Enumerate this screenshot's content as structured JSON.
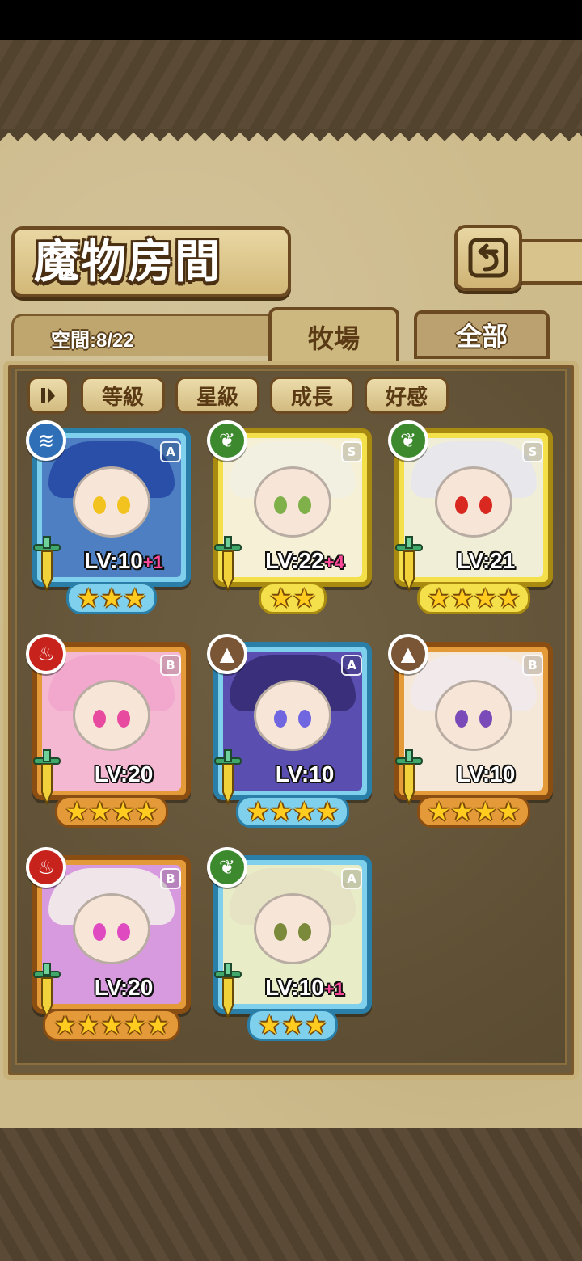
{
  "header": {
    "title": "魔物房間",
    "back_label": "返回"
  },
  "space": {
    "label": "空間:8/22"
  },
  "tabs": [
    {
      "label": "牧場",
      "active": true
    },
    {
      "label": "全部",
      "active": false
    }
  ],
  "sort": {
    "toggle_icon": "sort-toggle-icon",
    "buttons": [
      "等級",
      "星級",
      "成長",
      "好感"
    ]
  },
  "monsters": [
    {
      "level": "LV:10",
      "bonus": "+1",
      "rank": "A",
      "element": "water",
      "stars": 3,
      "frame": "blue"
    },
    {
      "level": "LV:22",
      "bonus": "+4",
      "rank": "S",
      "element": "nature",
      "stars": 2,
      "frame": "gold"
    },
    {
      "level": "LV:21",
      "bonus": "",
      "rank": "S",
      "element": "nature",
      "stars": 4,
      "frame": "gold"
    },
    {
      "level": "LV:20",
      "bonus": "",
      "rank": "B",
      "element": "fire",
      "stars": 4,
      "frame": "orange"
    },
    {
      "level": "LV:10",
      "bonus": "",
      "rank": "A",
      "element": "earth",
      "stars": 4,
      "frame": "blue"
    },
    {
      "level": "LV:10",
      "bonus": "",
      "rank": "B",
      "element": "earth",
      "stars": 4,
      "frame": "orange"
    },
    {
      "level": "LV:20",
      "bonus": "",
      "rank": "B",
      "element": "fire",
      "stars": 5,
      "frame": "orange"
    },
    {
      "level": "LV:10",
      "bonus": "+1",
      "rank": "A",
      "element": "nature",
      "stars": 3,
      "frame": "blue"
    }
  ],
  "colors": {
    "frame_blue": "#7fd0ec",
    "frame_gold": "#f4e04a",
    "frame_orange": "#e59a3a",
    "element_water": "#2f6fb8",
    "element_nature": "#3d8a2e",
    "element_fire": "#c8221c",
    "element_earth": "#7a5636",
    "bonus": "#ff4a9a"
  }
}
